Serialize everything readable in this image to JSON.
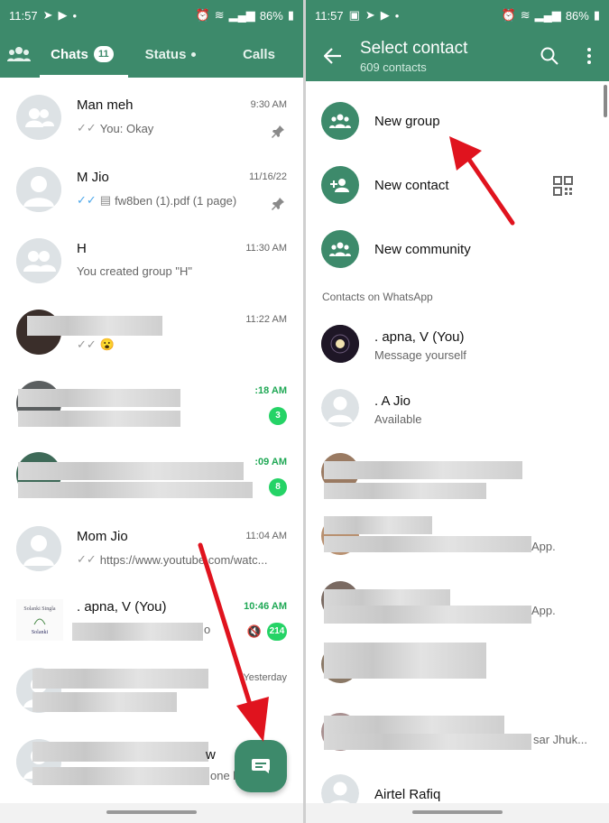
{
  "left": {
    "status": {
      "time": "11:57",
      "battery": "86%"
    },
    "tabs": {
      "chats": "Chats",
      "chats_badge": "11",
      "status": "Status",
      "calls": "Calls"
    },
    "chats": [
      {
        "name": "Man meh",
        "preview": "You: Okay",
        "time": "9:30 AM"
      },
      {
        "name": "M Jio",
        "preview": "fw8ben (1).pdf (1 page)",
        "time": "11/16/22"
      },
      {
        "name": "H",
        "preview": "You created group \"H\"",
        "time": "11:30 AM"
      },
      {
        "time": "11:22 AM"
      },
      {
        "time": ":18 AM",
        "count": "3"
      },
      {
        "time": ":09 AM",
        "count": "8"
      },
      {
        "name": "Mom Jio",
        "preview": "https://www.youtube.com/watc...",
        "time": "11:04 AM"
      },
      {
        "name": ". apna, V (You)",
        "preview_tail": "o",
        "time": "10:46 AM",
        "count": "214"
      },
      {
        "time": "Yesterday"
      },
      {
        "name_tail": "w",
        "preview_tail": "one l"
      }
    ]
  },
  "right": {
    "status": {
      "time": "11:57",
      "battery": "86%"
    },
    "header": {
      "title": "Select contact",
      "subtitle": "609 contacts"
    },
    "actions": {
      "new_group": "New group",
      "new_contact": "New contact",
      "new_community": "New community"
    },
    "section_label": "Contacts on WhatsApp",
    "contacts": [
      {
        "name": ". apna, V (You)",
        "status": "Message yourself"
      },
      {
        "name": ". A Jio",
        "status": "Available"
      },
      {
        "tail": "App."
      },
      {
        "tail": "App."
      },
      {
        "tail": "sar Jhuk..."
      },
      {
        "name": "Airtel Rafiq"
      }
    ]
  },
  "colors": {
    "brand": "#3d8a6b",
    "unread": "#25d366",
    "arrow": "#e0131e"
  }
}
